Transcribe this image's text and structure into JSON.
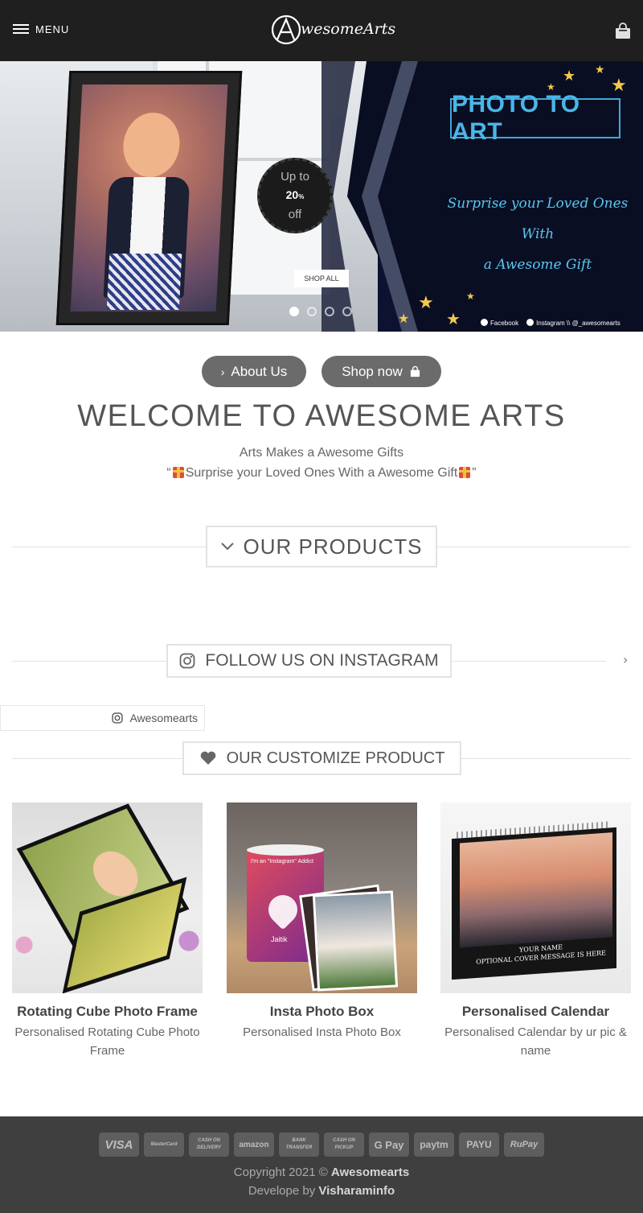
{
  "header": {
    "menu_label": "MENU",
    "logo_text": "wesomeArts",
    "logo_icon": "a-logo-icon",
    "cart_icon": "shopping-bag-icon"
  },
  "hero": {
    "badge": {
      "line1": "Up to",
      "value": "20",
      "unit": "%",
      "line2": "off"
    },
    "title": "PHOTO TO ART",
    "script_line1": "Surprise your Loved Ones With",
    "script_line2": "a Awesome Gift",
    "shop_all_label": "SHOP ALL",
    "slide_count": 4,
    "active_slide": 1,
    "social_facebook": "Facebook",
    "social_instagram": "Instagram \\\\ @_awesomearts"
  },
  "actions": {
    "about_label": "About Us",
    "shop_label": "Shop now"
  },
  "intro": {
    "heading": "WELCOME TO AWESOME ARTS",
    "subtitle": "Arts Makes a Awesome Gifts",
    "tagline_open": "“",
    "tagline": "Surprise your Loved Ones With a Awesome Gift",
    "tagline_close": "”"
  },
  "sections": {
    "products_title": "OUR PRODUCTS",
    "instagram_title": "FOLLOW US ON INSTAGRAM",
    "instagram_handle": "Awesomearts",
    "customize_title": "OUR CUSTOMIZE PRODUCT"
  },
  "products": [
    {
      "name": "Rotating Cube Photo Frame",
      "desc": "Personalised Rotating Cube Photo Frame"
    },
    {
      "name": "Insta Photo Box",
      "desc": "Personalised Insta Photo Box",
      "mug_caption": "Jaitik",
      "mug_text": "I'm an \"Instagram\" Addict"
    },
    {
      "name": "Personalised Calendar",
      "desc": "Personalised Calendar by ur pic & name",
      "cover_line1": "YOUR NAME",
      "cover_line2": "OPTIONAL COVER MESSAGE IS HERE"
    }
  ],
  "footer": {
    "payments": [
      "VISA",
      "MasterCard",
      "CASH ON DELIVERY",
      "amazon",
      "BANK TRANSFER",
      "CASH ON PICKUP",
      "G Pay",
      "paytm",
      "PAYU",
      "RuPay"
    ],
    "copyright_prefix": "Copyright 2021 ©",
    "copyright_brand": "Awesomearts",
    "developer_prefix": "Develope by",
    "developer_name": "Visharaminfo"
  },
  "colors": {
    "header_bg": "#1f1f1f",
    "button_bg": "#6b6b6b",
    "footer_bg": "#3f3f3f",
    "hero_accent": "#49b7e8"
  }
}
